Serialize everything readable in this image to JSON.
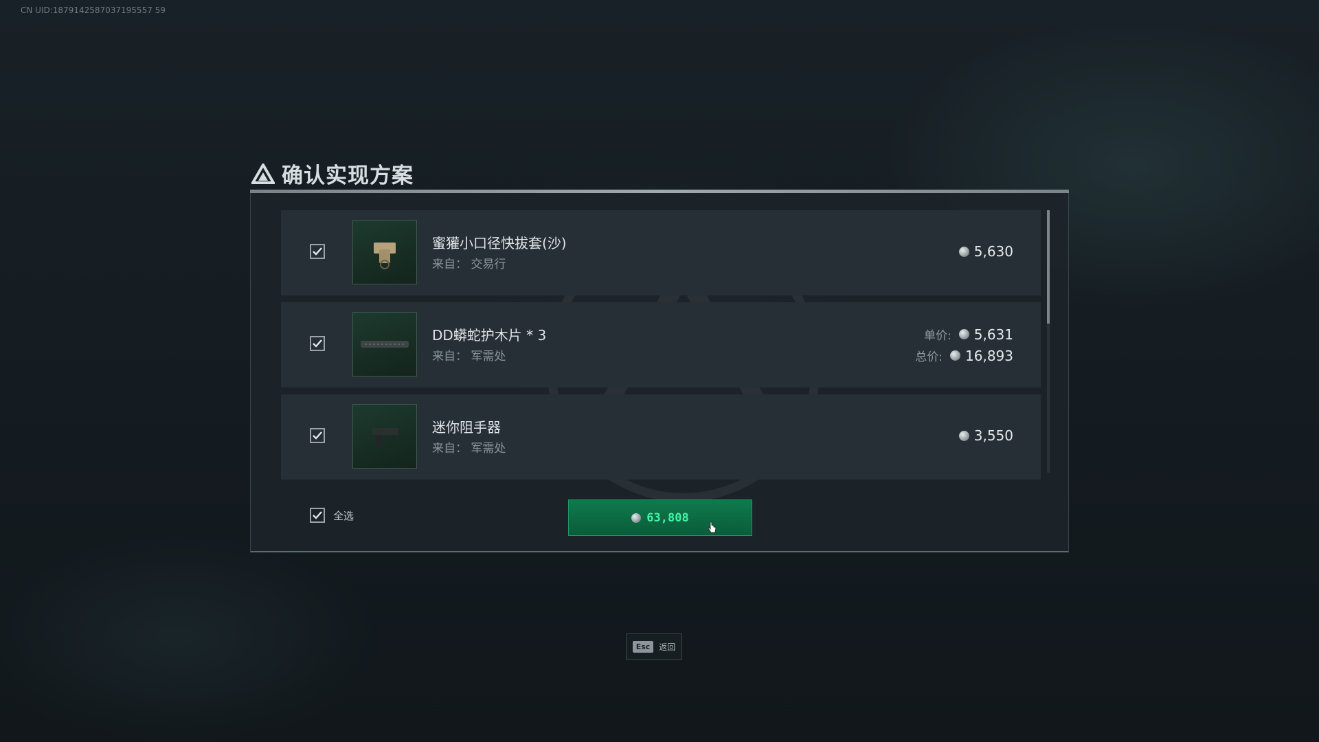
{
  "uid": "CN UID:1879142587037195557 59",
  "dialog": {
    "title": "确认实现方案",
    "items": [
      {
        "name": "蜜獾小口径快拔套(沙)",
        "source": "来自：  交易行",
        "price": "5,630",
        "checked": true,
        "icon": "holster-icon"
      },
      {
        "name": "DD蟒蛇护木片 * 3",
        "source": "来自：  军需处",
        "unit_price_label": "单价:",
        "unit_price": "5,631",
        "total_price_label": "总价:",
        "total_price": "16,893",
        "checked": true,
        "icon": "handguard-panel-icon"
      },
      {
        "name": "迷你阻手器",
        "source": "来自：  军需处",
        "price": "3,550",
        "checked": true,
        "icon": "handstop-icon"
      }
    ],
    "select_all_label": "全选",
    "confirm_amount": "63,808"
  },
  "footer": {
    "esc_key": "Esc",
    "esc_label": "返回"
  },
  "colors": {
    "confirm_bg": "#0f7a4d",
    "confirm_text": "#45f2a6",
    "panel_bg": "#1c2429",
    "row_bg": "#262f35"
  }
}
